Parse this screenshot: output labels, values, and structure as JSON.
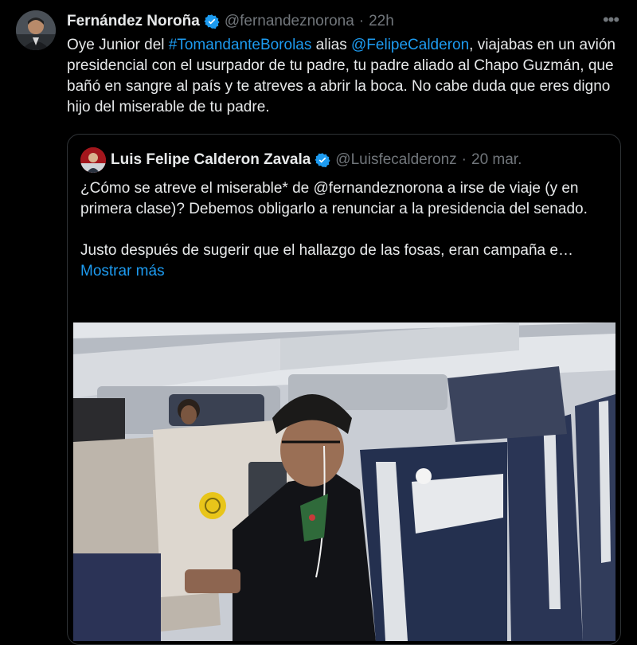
{
  "tweet": {
    "author_name": "Fernández Noroña",
    "author_handle": "@fernandeznorona",
    "separator": "·",
    "time": "22h",
    "more_icon": "more-horizontal-icon",
    "text_parts": [
      {
        "text": "Oye Junior del ",
        "link": false
      },
      {
        "text": "#TomandanteBorolas",
        "link": true
      },
      {
        "text": " alias ",
        "link": false
      },
      {
        "text": "@FelipeCalderon",
        "link": true
      },
      {
        "text": ", viajabas en un avión presidencial con el usurpador de tu padre, tu padre aliado al Chapo Guzmán, que bañó en sangre al país y te atreves a abrir la boca. No cabe duda que eres digno hijo del miserable de tu padre.",
        "link": false
      }
    ]
  },
  "quoted": {
    "author_name": "Luis Felipe Calderon Zavala",
    "author_handle": "@Luisfecalderonz",
    "separator": "·",
    "date": "20 mar.",
    "paragraph1": "¿Cómo se atreve el miserable* de @fernandeznorona a irse de viaje (y en primera clase)? Debemos obligarlo a renunciar a la presidencia del senado.",
    "paragraph2": "Justo después de sugerir que el hallazgo de las fosas, eran campaña e…",
    "show_more": "Mostrar más"
  },
  "colors": {
    "background": "#000000",
    "text": "#e7e9ea",
    "secondary": "#71767b",
    "link": "#1d9bf0",
    "border": "#2f3336",
    "verified": "#1d9bf0"
  }
}
